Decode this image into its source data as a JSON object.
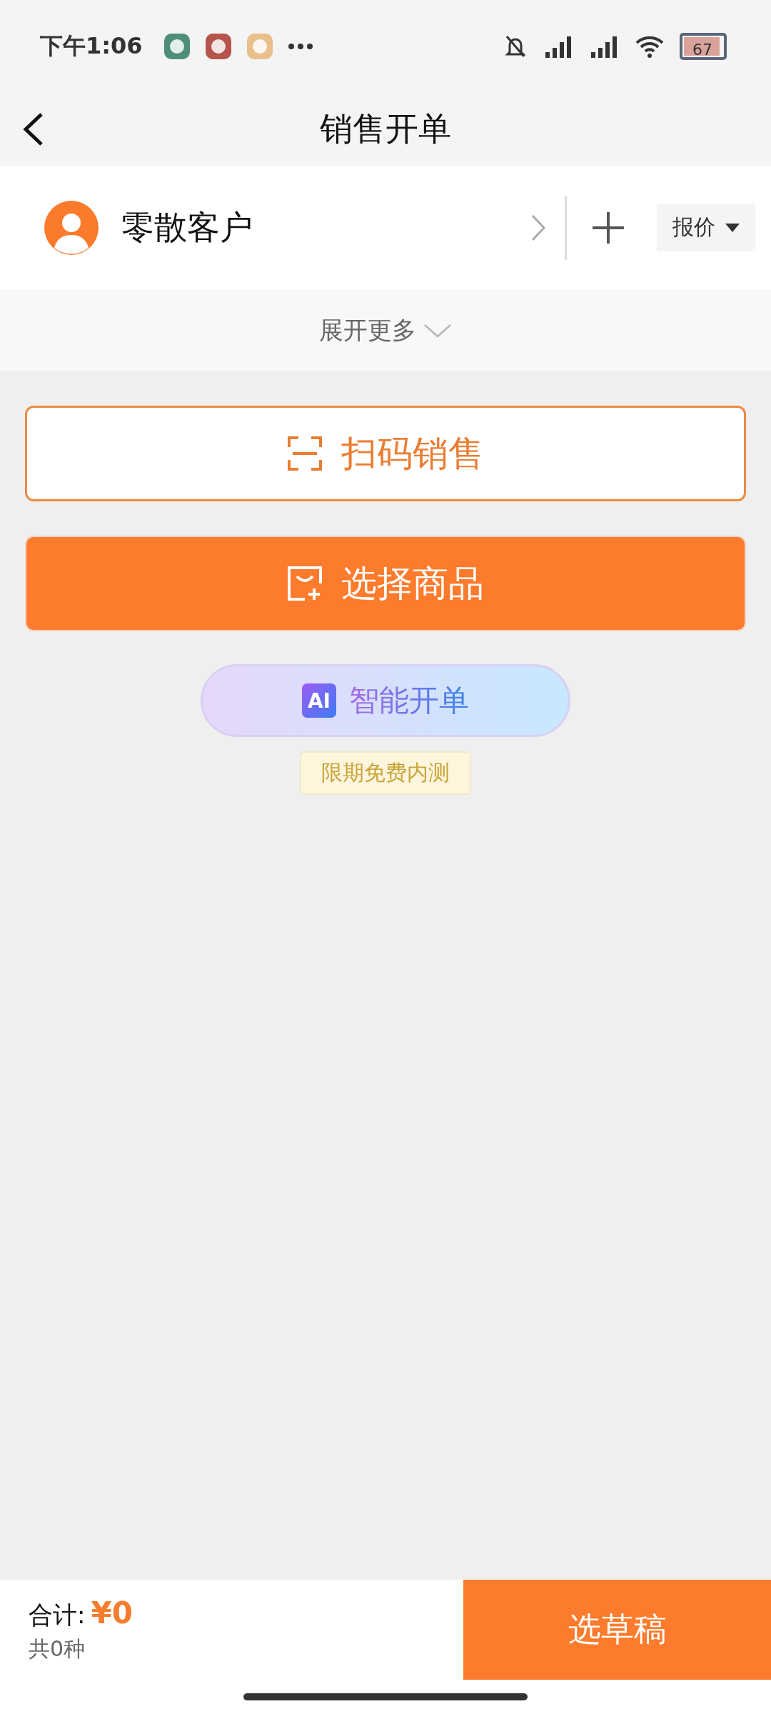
{
  "status_bar": {
    "time": "下午1:06",
    "battery": "67"
  },
  "nav": {
    "title": "销售开单"
  },
  "customer": {
    "name": "零散客户",
    "price_type": "报价"
  },
  "expand": {
    "label": "展开更多"
  },
  "actions": [
    {
      "kind": "outline",
      "label": "扫码销售"
    },
    {
      "kind": "filled",
      "label": "选择商品"
    }
  ],
  "ai": {
    "badge": "AI",
    "label": "智能开单",
    "tag": "限期免费内测"
  },
  "footer": {
    "total_label": "合计:",
    "total": "¥0",
    "count": "共0种",
    "button": "选草稿"
  }
}
